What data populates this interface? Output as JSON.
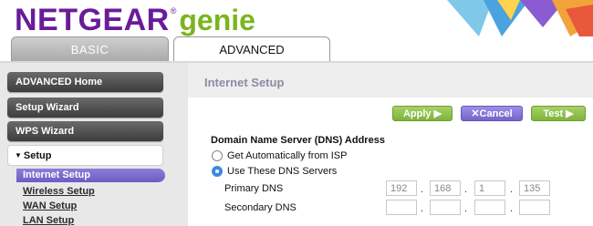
{
  "brand": {
    "name": "NETGEAR",
    "reg_mark": "®",
    "product": "genie",
    "primary_color": "#6a1b9a",
    "secondary_color": "#7ab51d"
  },
  "tabs": [
    {
      "label": "BASIC",
      "selected": false
    },
    {
      "label": "ADVANCED",
      "selected": true
    }
  ],
  "sidebar": {
    "items": [
      {
        "label": "ADVANCED Home"
      },
      {
        "label": "Setup Wizard"
      },
      {
        "label": "WPS Wizard"
      }
    ],
    "expanded": {
      "caret": "▼",
      "label": "Setup"
    },
    "sub_items": [
      {
        "label": "Internet Setup",
        "active": true
      },
      {
        "label": "Wireless Setup",
        "active": false
      },
      {
        "label": "WAN Setup",
        "active": false
      },
      {
        "label": "LAN Setup",
        "active": false
      }
    ]
  },
  "main": {
    "title": "Internet Setup",
    "buttons": {
      "apply": "Apply ▶",
      "cancel": "✕Cancel",
      "test": "Test ▶"
    },
    "dns": {
      "heading": "Domain Name Server (DNS) Address",
      "option_auto": "Get Automatically from ISP",
      "option_manual": "Use These DNS Servers",
      "selected": "manual",
      "primary_label": "Primary DNS",
      "primary": [
        "192",
        "168",
        "1",
        "135"
      ],
      "secondary_label": "Secondary DNS",
      "secondary": [
        "",
        "",
        "",
        ""
      ],
      "separator": "."
    }
  }
}
